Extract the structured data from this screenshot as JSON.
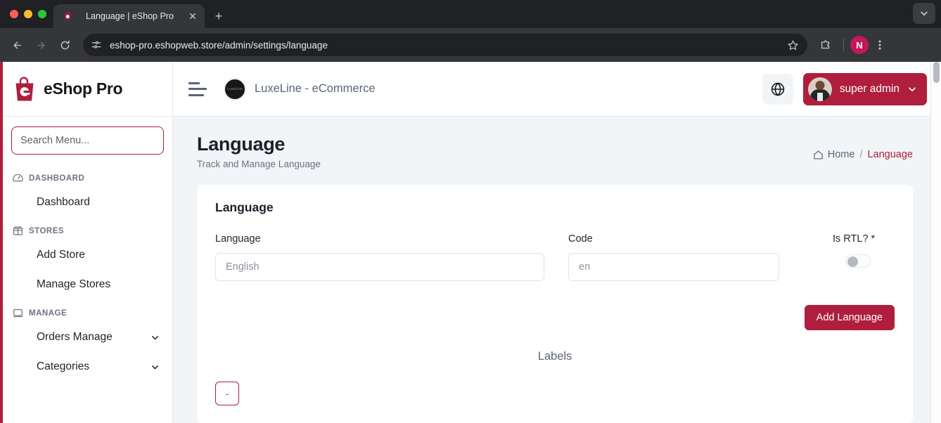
{
  "browser": {
    "tab": {
      "title": "Language | eShop Pro",
      "favicon": "eshop-favicon",
      "close_label": "✕"
    },
    "newtab_label": "+",
    "tabstrip_chevron": "chevron-down-icon",
    "nav": {
      "back": "back-arrow-icon",
      "forward": "forward-arrow-icon",
      "reload": "reload-icon"
    },
    "omnibox": {
      "url": "eshop-pro.eshopweb.store/admin/settings/language",
      "site_info_icon": "site-settings-icon",
      "star_icon": "bookmark-star-icon"
    },
    "extensions_icon": "extensions-puzzle-icon",
    "profile_initial": "N",
    "menu_icon": "kebab-menu-icon",
    "window_controls": [
      "close",
      "minimize",
      "maximize"
    ]
  },
  "sidebar": {
    "brand": {
      "name": "eShop Pro",
      "logo": "shopping-bag-logo"
    },
    "search": {
      "value": "",
      "placeholder": "Search Menu..."
    },
    "sections": [
      {
        "label": "DASHBOARD",
        "icon": "gauge-icon",
        "items": [
          {
            "label": "Dashboard",
            "expandable": false
          }
        ]
      },
      {
        "label": "STORES",
        "icon": "store-icon",
        "items": [
          {
            "label": "Add Store",
            "expandable": false
          },
          {
            "label": "Manage Stores",
            "expandable": false
          }
        ]
      },
      {
        "label": "MANAGE",
        "icon": "monitor-icon",
        "items": [
          {
            "label": "Orders Manage",
            "expandable": true
          },
          {
            "label": "Categories",
            "expandable": true
          }
        ]
      }
    ]
  },
  "topbar": {
    "menu_toggle_icon": "hamburger-icon",
    "store": {
      "name": "LuxeLine - eCommerce",
      "avatar": "store-avatar"
    },
    "language_icon": "globe-icon",
    "user": {
      "name": "super admin",
      "avatar": "user-avatar",
      "chevron": "chevron-down-icon"
    }
  },
  "page": {
    "title": "Language",
    "subtitle": "Track and Manage Language",
    "breadcrumb": {
      "home_icon": "home-icon",
      "home": "Home",
      "separator": "/",
      "current": "Language"
    }
  },
  "form": {
    "card_title": "Language",
    "fields": {
      "language": {
        "label": "Language",
        "value": "",
        "placeholder": "English"
      },
      "code": {
        "label": "Code",
        "value": "",
        "placeholder": "en"
      },
      "is_rtl": {
        "label": "Is RTL?",
        "required_mark": "*",
        "value": "off"
      }
    },
    "submit_label": "Add Language"
  },
  "labels_section": {
    "heading": "Labels",
    "remove_button_label": "-"
  },
  "colors": {
    "brand_crimson": "#AF1E3C",
    "page_background": "#f1f5f7",
    "card_background": "#ffffff",
    "text_dark": "#1b2029",
    "text_muted": "#6b7280",
    "slate": "#5a6575",
    "required_red": "#e4233a"
  }
}
